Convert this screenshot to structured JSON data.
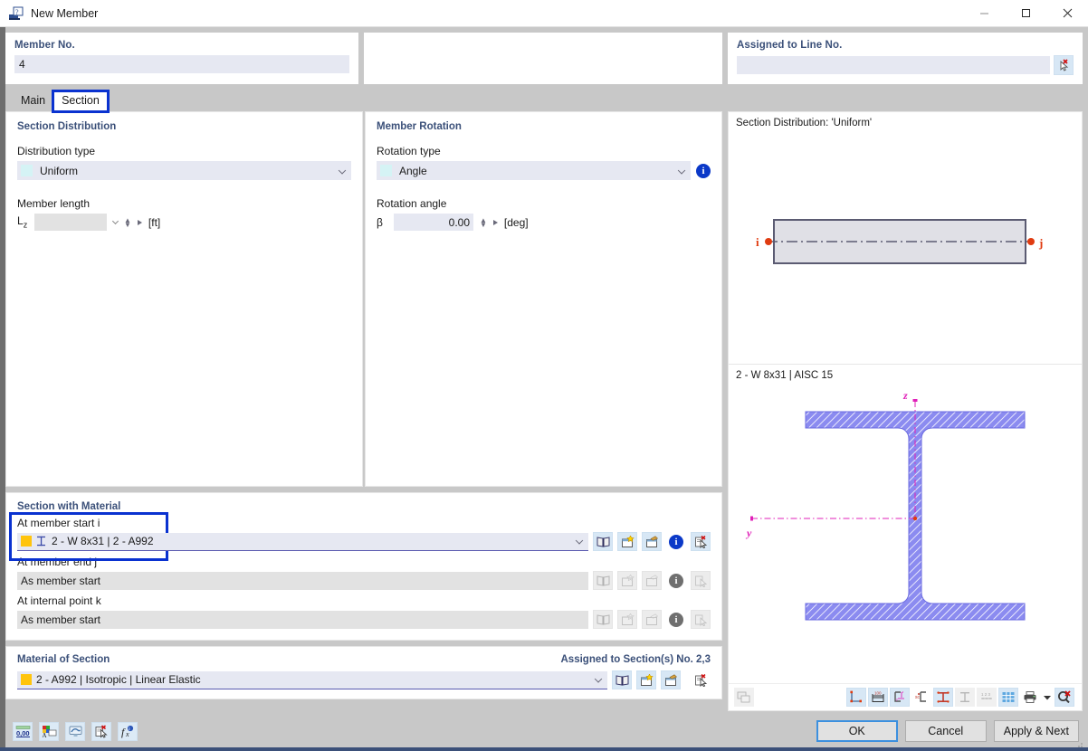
{
  "window": {
    "title": "New Member",
    "icon": "new-member-icon",
    "controls": {
      "minimize": "–",
      "maximize": "□",
      "close": "✕"
    }
  },
  "header": {
    "member_no": {
      "label": "Member No.",
      "value": "4"
    },
    "assigned_to_line": {
      "label": "Assigned to Line No.",
      "value": "",
      "pick_icon": "pick-line-icon"
    }
  },
  "tabs": [
    {
      "label": "Main",
      "active": false
    },
    {
      "label": "Section",
      "active": true,
      "highlighted": true
    }
  ],
  "section_distribution": {
    "title": "Section Distribution",
    "distribution_type": {
      "label": "Distribution type",
      "value": "Uniform"
    },
    "member_length": {
      "label": "Member length",
      "symbol": "Lz",
      "value": "",
      "unit": "[ft]"
    }
  },
  "member_rotation": {
    "title": "Member Rotation",
    "rotation_type": {
      "label": "Rotation type",
      "value": "Angle",
      "info_icon": "info-icon"
    },
    "rotation_angle": {
      "label": "Rotation angle",
      "symbol": "β",
      "value": "0.00",
      "unit": "[deg]"
    }
  },
  "section_with_material": {
    "title": "Section with Material",
    "rows": [
      {
        "label": "At member start i",
        "value": "2 - W 8x31 | 2 - A992",
        "disabled": false,
        "highlighted": true,
        "swatch": "#ffc40d"
      },
      {
        "label": "At member end j",
        "value": "As member start",
        "disabled": true,
        "highlighted": false
      },
      {
        "label": "At internal point k",
        "value": "As member start",
        "disabled": true,
        "highlighted": false
      }
    ],
    "row_icons": [
      "library-icon",
      "new-section-icon",
      "edit-section-icon",
      "info-icon",
      "delete-pick-icon"
    ]
  },
  "material_of_section": {
    "title": "Material of Section",
    "assigned_text": "Assigned to Section(s) No. 2,3",
    "value": "2 - A992 | Isotropic | Linear Elastic",
    "swatch": "#ffc40d",
    "icons": [
      "library-icon",
      "new-material-icon",
      "edit-material-icon",
      "delete-pick-icon"
    ]
  },
  "preview": {
    "distribution_caption": "Section Distribution: 'Uniform'",
    "node_start": "i",
    "node_end": "j",
    "section_caption": "2 - W 8x31 | AISC 15",
    "axis_z": "z",
    "axis_y": "y",
    "colors": {
      "section_fill": "#7b7bee",
      "axis": "#e020b8",
      "node": "#e03b10"
    },
    "toolbar_icons": [
      "corner-dimensions-icon",
      "overall-dimensions-icon",
      "local-axes-icon",
      "shear-center-icon",
      "stress-points-icon",
      "section-parts-icon",
      "numbering-icon",
      "grid-icon",
      "print-icon",
      "print-dropdown-icon",
      "close-view-icon"
    ],
    "toolbar_left_icon": "snapshot-icon"
  },
  "bottom": {
    "icons": [
      "decimal-places-icon",
      "display-properties-icon",
      "visual-icon",
      "delete-pick-icon",
      "formula-icon"
    ],
    "buttons": [
      {
        "label": "OK",
        "primary": true
      },
      {
        "label": "Cancel",
        "primary": false
      },
      {
        "label": "Apply & Next",
        "primary": false
      }
    ]
  }
}
